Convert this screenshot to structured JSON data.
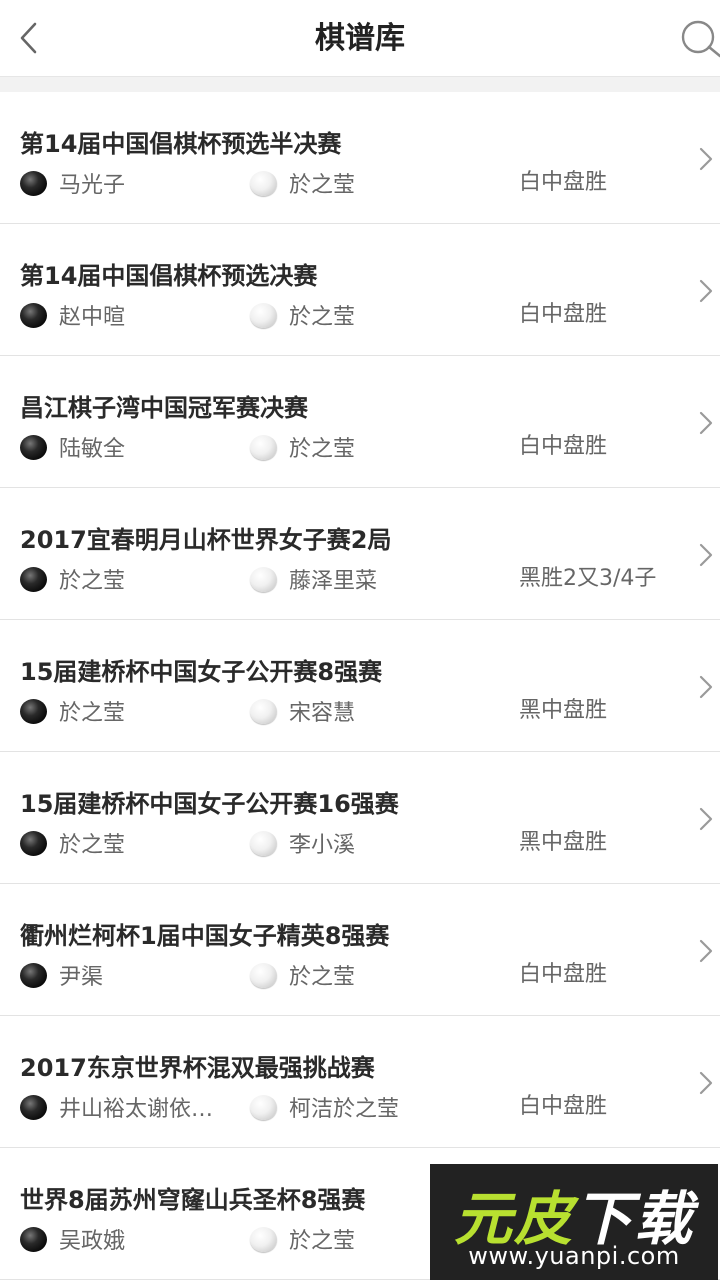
{
  "header": {
    "title": "棋谱库",
    "back_icon": "chevron-left-icon",
    "search_icon": "search-icon"
  },
  "games": [
    {
      "title": "第14届中国倡棋杯预选半决赛",
      "black": "马光子",
      "white": "於之莹",
      "result": "白中盘胜"
    },
    {
      "title": "第14届中国倡棋杯预选决赛",
      "black": "赵中暄",
      "white": "於之莹",
      "result": "白中盘胜"
    },
    {
      "title": "昌江棋子湾中国冠军赛决赛",
      "black": "陆敏全",
      "white": "於之莹",
      "result": "白中盘胜"
    },
    {
      "title": "2017宜春明月山杯世界女子赛2局",
      "black": "於之莹",
      "white": "藤泽里菜",
      "result": "黑胜2又3/4子"
    },
    {
      "title": "15届建桥杯中国女子公开赛8强赛",
      "black": "於之莹",
      "white": "宋容慧",
      "result": "黑中盘胜"
    },
    {
      "title": "15届建桥杯中国女子公开赛16强赛",
      "black": "於之莹",
      "white": "李小溪",
      "result": "黑中盘胜"
    },
    {
      "title": "衢州烂柯杯1届中国女子精英8强赛",
      "black": "尹渠",
      "white": "於之莹",
      "result": "白中盘胜"
    },
    {
      "title": "2017东京世界杯混双最强挑战赛",
      "black": "井山裕太谢依…",
      "white": "柯洁於之莹",
      "result": "白中盘胜"
    },
    {
      "title": "世界8届苏州穹窿山兵圣杯8强赛",
      "black": "吴政娥",
      "white": "於之莹",
      "result": ""
    }
  ],
  "watermark": {
    "logo_a": "元皮",
    "logo_b": "下载",
    "url": "www.yuanpi.com"
  },
  "colors": {
    "accent_watermark": "#b8e030",
    "background": "#f2f2f2",
    "divider": "#e3e3e3"
  }
}
